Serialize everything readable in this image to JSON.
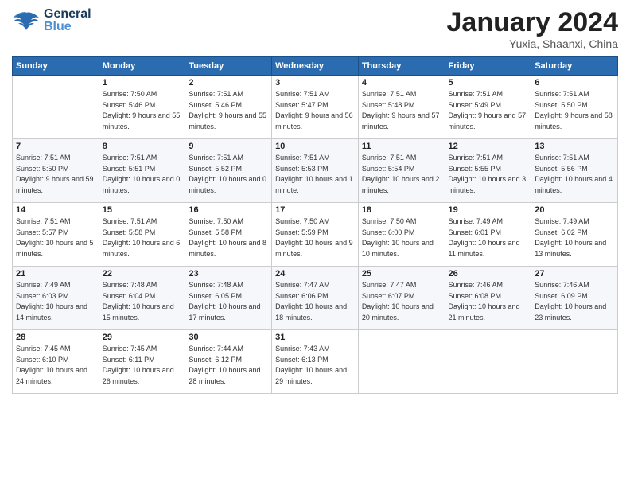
{
  "header": {
    "logo_general": "General",
    "logo_blue": "Blue",
    "title": "January 2024",
    "location": "Yuxia, Shaanxi, China"
  },
  "weekdays": [
    "Sunday",
    "Monday",
    "Tuesday",
    "Wednesday",
    "Thursday",
    "Friday",
    "Saturday"
  ],
  "weeks": [
    [
      {
        "day": "",
        "sunrise": "",
        "sunset": "",
        "daylight": ""
      },
      {
        "day": "1",
        "sunrise": "Sunrise: 7:50 AM",
        "sunset": "Sunset: 5:46 PM",
        "daylight": "Daylight: 9 hours and 55 minutes."
      },
      {
        "day": "2",
        "sunrise": "Sunrise: 7:51 AM",
        "sunset": "Sunset: 5:46 PM",
        "daylight": "Daylight: 9 hours and 55 minutes."
      },
      {
        "day": "3",
        "sunrise": "Sunrise: 7:51 AM",
        "sunset": "Sunset: 5:47 PM",
        "daylight": "Daylight: 9 hours and 56 minutes."
      },
      {
        "day": "4",
        "sunrise": "Sunrise: 7:51 AM",
        "sunset": "Sunset: 5:48 PM",
        "daylight": "Daylight: 9 hours and 57 minutes."
      },
      {
        "day": "5",
        "sunrise": "Sunrise: 7:51 AM",
        "sunset": "Sunset: 5:49 PM",
        "daylight": "Daylight: 9 hours and 57 minutes."
      },
      {
        "day": "6",
        "sunrise": "Sunrise: 7:51 AM",
        "sunset": "Sunset: 5:50 PM",
        "daylight": "Daylight: 9 hours and 58 minutes."
      }
    ],
    [
      {
        "day": "7",
        "sunrise": "Sunrise: 7:51 AM",
        "sunset": "Sunset: 5:50 PM",
        "daylight": "Daylight: 9 hours and 59 minutes."
      },
      {
        "day": "8",
        "sunrise": "Sunrise: 7:51 AM",
        "sunset": "Sunset: 5:51 PM",
        "daylight": "Daylight: 10 hours and 0 minutes."
      },
      {
        "day": "9",
        "sunrise": "Sunrise: 7:51 AM",
        "sunset": "Sunset: 5:52 PM",
        "daylight": "Daylight: 10 hours and 0 minutes."
      },
      {
        "day": "10",
        "sunrise": "Sunrise: 7:51 AM",
        "sunset": "Sunset: 5:53 PM",
        "daylight": "Daylight: 10 hours and 1 minute."
      },
      {
        "day": "11",
        "sunrise": "Sunrise: 7:51 AM",
        "sunset": "Sunset: 5:54 PM",
        "daylight": "Daylight: 10 hours and 2 minutes."
      },
      {
        "day": "12",
        "sunrise": "Sunrise: 7:51 AM",
        "sunset": "Sunset: 5:55 PM",
        "daylight": "Daylight: 10 hours and 3 minutes."
      },
      {
        "day": "13",
        "sunrise": "Sunrise: 7:51 AM",
        "sunset": "Sunset: 5:56 PM",
        "daylight": "Daylight: 10 hours and 4 minutes."
      }
    ],
    [
      {
        "day": "14",
        "sunrise": "Sunrise: 7:51 AM",
        "sunset": "Sunset: 5:57 PM",
        "daylight": "Daylight: 10 hours and 5 minutes."
      },
      {
        "day": "15",
        "sunrise": "Sunrise: 7:51 AM",
        "sunset": "Sunset: 5:58 PM",
        "daylight": "Daylight: 10 hours and 6 minutes."
      },
      {
        "day": "16",
        "sunrise": "Sunrise: 7:50 AM",
        "sunset": "Sunset: 5:58 PM",
        "daylight": "Daylight: 10 hours and 8 minutes."
      },
      {
        "day": "17",
        "sunrise": "Sunrise: 7:50 AM",
        "sunset": "Sunset: 5:59 PM",
        "daylight": "Daylight: 10 hours and 9 minutes."
      },
      {
        "day": "18",
        "sunrise": "Sunrise: 7:50 AM",
        "sunset": "Sunset: 6:00 PM",
        "daylight": "Daylight: 10 hours and 10 minutes."
      },
      {
        "day": "19",
        "sunrise": "Sunrise: 7:49 AM",
        "sunset": "Sunset: 6:01 PM",
        "daylight": "Daylight: 10 hours and 11 minutes."
      },
      {
        "day": "20",
        "sunrise": "Sunrise: 7:49 AM",
        "sunset": "Sunset: 6:02 PM",
        "daylight": "Daylight: 10 hours and 13 minutes."
      }
    ],
    [
      {
        "day": "21",
        "sunrise": "Sunrise: 7:49 AM",
        "sunset": "Sunset: 6:03 PM",
        "daylight": "Daylight: 10 hours and 14 minutes."
      },
      {
        "day": "22",
        "sunrise": "Sunrise: 7:48 AM",
        "sunset": "Sunset: 6:04 PM",
        "daylight": "Daylight: 10 hours and 15 minutes."
      },
      {
        "day": "23",
        "sunrise": "Sunrise: 7:48 AM",
        "sunset": "Sunset: 6:05 PM",
        "daylight": "Daylight: 10 hours and 17 minutes."
      },
      {
        "day": "24",
        "sunrise": "Sunrise: 7:47 AM",
        "sunset": "Sunset: 6:06 PM",
        "daylight": "Daylight: 10 hours and 18 minutes."
      },
      {
        "day": "25",
        "sunrise": "Sunrise: 7:47 AM",
        "sunset": "Sunset: 6:07 PM",
        "daylight": "Daylight: 10 hours and 20 minutes."
      },
      {
        "day": "26",
        "sunrise": "Sunrise: 7:46 AM",
        "sunset": "Sunset: 6:08 PM",
        "daylight": "Daylight: 10 hours and 21 minutes."
      },
      {
        "day": "27",
        "sunrise": "Sunrise: 7:46 AM",
        "sunset": "Sunset: 6:09 PM",
        "daylight": "Daylight: 10 hours and 23 minutes."
      }
    ],
    [
      {
        "day": "28",
        "sunrise": "Sunrise: 7:45 AM",
        "sunset": "Sunset: 6:10 PM",
        "daylight": "Daylight: 10 hours and 24 minutes."
      },
      {
        "day": "29",
        "sunrise": "Sunrise: 7:45 AM",
        "sunset": "Sunset: 6:11 PM",
        "daylight": "Daylight: 10 hours and 26 minutes."
      },
      {
        "day": "30",
        "sunrise": "Sunrise: 7:44 AM",
        "sunset": "Sunset: 6:12 PM",
        "daylight": "Daylight: 10 hours and 28 minutes."
      },
      {
        "day": "31",
        "sunrise": "Sunrise: 7:43 AM",
        "sunset": "Sunset: 6:13 PM",
        "daylight": "Daylight: 10 hours and 29 minutes."
      },
      {
        "day": "",
        "sunrise": "",
        "sunset": "",
        "daylight": ""
      },
      {
        "day": "",
        "sunrise": "",
        "sunset": "",
        "daylight": ""
      },
      {
        "day": "",
        "sunrise": "",
        "sunset": "",
        "daylight": ""
      }
    ]
  ]
}
